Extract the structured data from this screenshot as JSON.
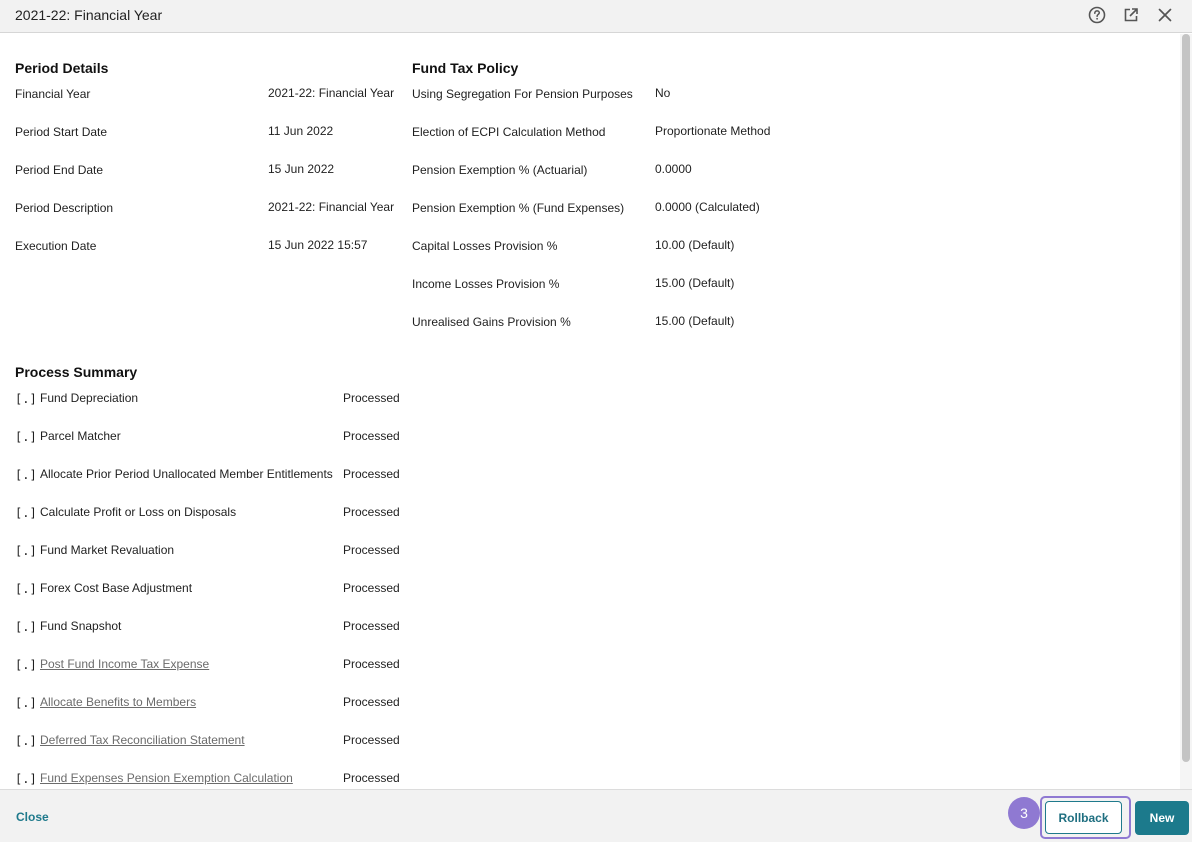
{
  "dialog": {
    "title": "2021-22: Financial Year",
    "icons": [
      "help-icon",
      "external-link-icon",
      "close-icon"
    ]
  },
  "period_details": {
    "title": "Period Details",
    "rows": [
      {
        "label": "Financial Year",
        "value": "2021-22: Financial Year"
      },
      {
        "label": "Period Start Date",
        "value": "11 Jun 2022"
      },
      {
        "label": "Period End Date",
        "value": "15 Jun 2022"
      },
      {
        "label": "Period Description",
        "value": "2021-22: Financial Year"
      },
      {
        "label": "Execution Date",
        "value": "15 Jun 2022 15:57"
      }
    ]
  },
  "fund_tax_policy": {
    "title": "Fund Tax Policy",
    "rows": [
      {
        "label": "Using Segregation For Pension Purposes",
        "value": "No"
      },
      {
        "label": "Election of ECPI Calculation Method",
        "value": "Proportionate Method"
      },
      {
        "label": "Pension Exemption % (Actuarial)",
        "value": "0.0000"
      },
      {
        "label": "Pension Exemption % (Fund Expenses)",
        "value": "0.0000 (Calculated)"
      },
      {
        "label": "Capital Losses Provision %",
        "value": "10.00 (Default)"
      },
      {
        "label": "Income Losses Provision %",
        "value": "15.00 (Default)"
      },
      {
        "label": "Unrealised Gains Provision %",
        "value": "15.00 (Default)"
      }
    ]
  },
  "process_summary": {
    "title": "Process Summary",
    "rows": [
      {
        "mark": "[.]",
        "name": "Fund Depreciation",
        "status": "Processed"
      },
      {
        "mark": "[.]",
        "name": "Parcel Matcher",
        "status": "Processed"
      },
      {
        "mark": "[.]",
        "name": "Allocate Prior Period Unallocated Member Entitlements",
        "status": "Processed"
      },
      {
        "mark": "[.]",
        "name": "Calculate Profit or Loss on Disposals",
        "status": "Processed"
      },
      {
        "mark": "[.]",
        "name": "Fund Market Revaluation",
        "status": "Processed"
      },
      {
        "mark": "[.]",
        "name": "Forex Cost Base Adjustment",
        "status": "Processed"
      },
      {
        "mark": "[.]",
        "name": "Fund Snapshot",
        "status": "Processed"
      },
      {
        "mark": "[.]",
        "name": "Post Fund Income Tax Expense",
        "status": "Processed"
      },
      {
        "mark": "[.]",
        "name": "Allocate Benefits to Members",
        "status": "Processed"
      },
      {
        "mark": "[.]",
        "name": "Deferred Tax Reconciliation Statement",
        "status": "Processed"
      },
      {
        "mark": "[.]",
        "name": "Fund Expenses Pension Exemption Calculation",
        "status": "Processed"
      }
    ]
  },
  "footer": {
    "close_label": "Close",
    "step_badge": "3",
    "rollback_label": "Rollback",
    "new_label": "New"
  },
  "colors": {
    "accent": "#1c7a8c",
    "highlight": "#8f79d2",
    "link_muted": "#6b6b6b"
  }
}
